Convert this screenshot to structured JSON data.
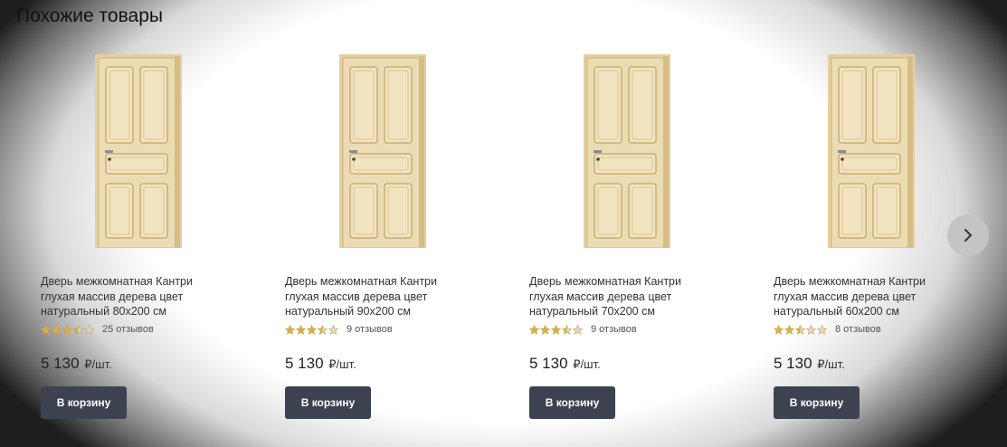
{
  "section": {
    "title": "Похожие товары"
  },
  "colors": {
    "button_bg": "#3d4250",
    "star_filled": "#d9b04a",
    "star_empty": "#d8d8d8",
    "door_wood": "#ecdcb4"
  },
  "products": [
    {
      "title": "Дверь межкомнатная Кантри глухая массив дерева цвет натуральный 80x200 см",
      "rating": 3.5,
      "reviews": "25 отзывов",
      "price": "5 130",
      "unit": "₽/шт.",
      "button": "В корзину",
      "image_icon": "door-image"
    },
    {
      "title": "Дверь межкомнатная Кантри глухая массив дерева цвет натуральный 90x200 см",
      "rating": 3.5,
      "reviews": "9 отзывов",
      "price": "5 130",
      "unit": "₽/шт.",
      "button": "В корзину",
      "image_icon": "door-image"
    },
    {
      "title": "Дверь межкомнатная Кантри глухая массив дерева цвет натуральный 70x200 см",
      "rating": 3.5,
      "reviews": "9 отзывов",
      "price": "5 130",
      "unit": "₽/шт.",
      "button": "В корзину",
      "image_icon": "door-image"
    },
    {
      "title": "Дверь межкомнатная Кантри глухая массив дерева цвет натуральный 60x200 см",
      "rating": 2.5,
      "reviews": "8 отзывов",
      "price": "5 130",
      "unit": "₽/шт.",
      "button": "В корзину",
      "image_icon": "door-image"
    }
  ],
  "carousel": {
    "next_icon": "chevron-right-icon"
  }
}
